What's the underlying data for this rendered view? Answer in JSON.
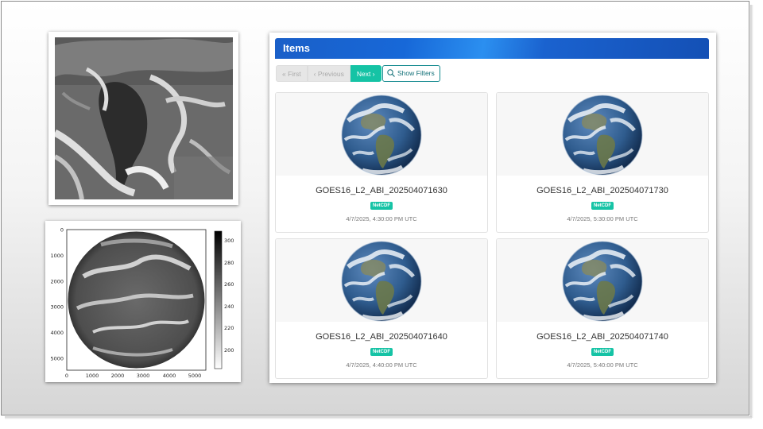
{
  "items_panel": {
    "title": "Items",
    "pagination": {
      "first": "« First",
      "previous": "‹ Previous",
      "next": "Next ›"
    },
    "show_filters_label": "Show Filters",
    "items": [
      {
        "name": "GOES16_L2_ABI_202504071630",
        "format": "NetCDF",
        "timestamp": "4/7/2025, 4:30:00 PM UTC",
        "thumbnail": "earth-globe"
      },
      {
        "name": "GOES16_L2_ABI_202504071730",
        "format": "NetCDF",
        "timestamp": "4/7/2025, 5:30:00 PM UTC",
        "thumbnail": "earth-globe"
      },
      {
        "name": "GOES16_L2_ABI_202504071640",
        "format": "NetCDF",
        "timestamp": "4/7/2025, 4:40:00 PM UTC",
        "thumbnail": "earth-globe"
      },
      {
        "name": "GOES16_L2_ABI_202504071740",
        "format": "NetCDF",
        "timestamp": "4/7/2025, 5:40:00 PM UTC",
        "thumbnail": "earth-globe"
      }
    ]
  },
  "plot": {
    "x_ticks": [
      "0",
      "1000",
      "2000",
      "3000",
      "4000",
      "5000"
    ],
    "y_ticks": [
      "0",
      "1000",
      "2000",
      "3000",
      "4000",
      "5000"
    ],
    "colorbar_ticks": [
      "300",
      "280",
      "260",
      "240",
      "220",
      "200"
    ],
    "colormap": "grayscale"
  },
  "colors": {
    "accent": "#15c3a5",
    "header_blue": "#1768d8",
    "ocean": "#2a4f7e"
  }
}
